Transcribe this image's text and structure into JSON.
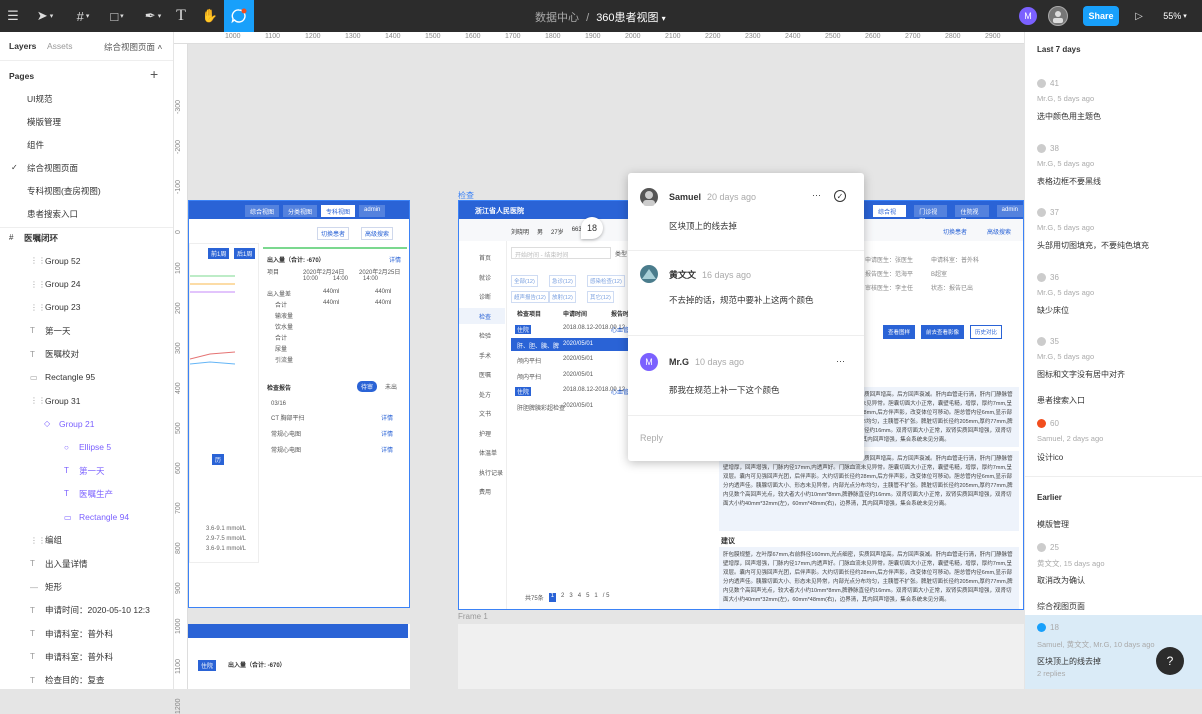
{
  "toolbar": {
    "breadcrumb_parent": "数据中心",
    "breadcrumb_sep": "/",
    "file_name": "360患者视图",
    "avatar_letter": "M",
    "share_label": "Share",
    "zoom": "55%"
  },
  "left_panel": {
    "tab_layers": "Layers",
    "tab_assets": "Assets",
    "page_select": "综合视图页面",
    "pages_title": "Pages",
    "pages": [
      "UI规范",
      "模版管理",
      "组件",
      "综合视图页面",
      "专科视图(查房视图)",
      "患者搜索入口"
    ],
    "current_page_index": 3,
    "layers": [
      {
        "icon": "#",
        "label": "医嘱闭环",
        "indent": 0
      },
      {
        "icon": "⋮⋮",
        "label": "Group 52",
        "indent": 1
      },
      {
        "icon": "⋮⋮",
        "label": "Group 24",
        "indent": 1
      },
      {
        "icon": "⋮⋮",
        "label": "Group 23",
        "indent": 1
      },
      {
        "icon": "T",
        "label": "第一天",
        "indent": 1
      },
      {
        "icon": "T",
        "label": "医嘱校对",
        "indent": 1
      },
      {
        "icon": "▭",
        "label": "Rectangle 95",
        "indent": 1
      },
      {
        "icon": "⋮⋮",
        "label": "Group 31",
        "indent": 1
      },
      {
        "icon": "◇",
        "label": "Group 21",
        "indent": 2
      },
      {
        "icon": "○",
        "label": "Ellipse 5",
        "indent": 3
      },
      {
        "icon": "T",
        "label": "第一天",
        "indent": 3
      },
      {
        "icon": "T",
        "label": "医嘱生产",
        "indent": 3
      },
      {
        "icon": "▭",
        "label": "Rectangle 94",
        "indent": 3
      },
      {
        "icon": "⋮⋮",
        "label": "编组",
        "indent": 1
      },
      {
        "icon": "T",
        "label": "出入量详情",
        "indent": 1
      },
      {
        "icon": "—",
        "label": "矩形",
        "indent": 1
      },
      {
        "icon": "T",
        "label": "申请时间：2020-05-10 12:3",
        "indent": 1
      },
      {
        "icon": "T",
        "label": "申请科室：普外科",
        "indent": 1
      },
      {
        "icon": "T",
        "label": "申请科室：普外科",
        "indent": 1
      },
      {
        "icon": "T",
        "label": "检查目的：复查",
        "indent": 1
      }
    ]
  },
  "ruler": {
    "h": [
      "1000",
      "1100",
      "1200",
      "1300",
      "1400",
      "1500",
      "1600",
      "1700",
      "1800",
      "1900",
      "2000",
      "2100",
      "2200",
      "2300",
      "2400",
      "2500",
      "2600",
      "2700",
      "2800",
      "2900"
    ],
    "v": [
      "-300",
      "-200",
      "-100",
      "0",
      "100",
      "200",
      "300",
      "400",
      "500",
      "600",
      "700",
      "800",
      "900",
      "1000",
      "1100",
      "1200"
    ]
  },
  "canvas": {
    "frame_label_check": "检查",
    "frame_label_frame1": "Frame 1",
    "comment_pin": "18",
    "left_mock": {
      "tabs": [
        "综合视图",
        "分类视图",
        "专科视图",
        "admin"
      ],
      "btn1": "切换患者",
      "btn2": "高级搜索",
      "io_title": "出入量（合计: -670）",
      "io_detail": "详情",
      "io_head": [
        "项目",
        "2020年2月24日",
        "2020年2月25日"
      ],
      "io_times": [
        "10:00",
        "14:00",
        "14:00"
      ],
      "io_rows": [
        [
          "出入量差",
          "440ml",
          "440ml"
        ],
        [
          "合计",
          "440ml",
          "440ml"
        ],
        [
          "输液量",
          "",
          ""
        ],
        [
          "饮水量",
          "",
          ""
        ],
        [
          "合计",
          "",
          ""
        ],
        [
          "尿量",
          "",
          ""
        ],
        [
          "引流量",
          "",
          ""
        ]
      ],
      "report_title": "检查报告",
      "report_toggle": [
        "待审",
        "未出"
      ],
      "report_date": "03/16",
      "reports": [
        [
          "CT 胸部平扫",
          "详情"
        ],
        [
          "常规心电图",
          "详情"
        ],
        [
          "常规心电图",
          "详情"
        ]
      ],
      "week_tabs": [
        "前1周",
        "后1周"
      ],
      "labs": [
        "3.6-9.1 mmol/L",
        "2.9-7.5 mmol/L",
        "3.6-9.1 mmol/L"
      ]
    },
    "main_mock": {
      "hospital": "浙江省人民医院",
      "tabs": [
        "综合视图",
        "门诊视图",
        "住院视图",
        "admin"
      ],
      "patient": [
        "刘晓明",
        "男",
        "27岁",
        "66343"
      ],
      "btn_switch": "切换患者",
      "btn_search": "高级搜索",
      "nav": [
        "首页",
        "就诊",
        "诊断",
        "检查",
        "检验",
        "手术",
        "医嘱",
        "处方",
        "文书",
        "护理",
        "体温单",
        "执行记录",
        "费用"
      ],
      "filters": [
        "类型"
      ],
      "chips": [
        "全部(12)",
        "急诊(12)",
        "感染检查(12)",
        "超声报告(12)",
        "放射(12)",
        "其它(12)"
      ],
      "table_head": [
        "检查项目",
        "申请时间",
        "报告时"
      ],
      "rows": [
        [
          "住院",
          "2018.08.12-2018.09.12",
          "心血管内"
        ],
        [
          "肝、胆、胰、脾",
          "2020/05/01",
          ""
        ],
        [
          "颅内平扫",
          "2020/05/01",
          ""
        ],
        [
          "颅内平扫",
          "2020/05/01",
          ""
        ],
        [
          "住院",
          "2018.08.12-2018.09.12",
          "心血管内"
        ],
        [
          "肝胆脾胰彩超检查",
          "2020/05/01",
          ""
        ]
      ],
      "pager": [
        "共75条",
        "1",
        "2",
        "3",
        "4",
        "5",
        "1",
        "/ 5"
      ],
      "detail_right": [
        [
          "申请医生：张医生",
          "申请科室：普外科"
        ],
        [
          "报告医生：范海平",
          "B超室"
        ],
        [
          "审核医生：李主任",
          "状态：报告已出"
        ]
      ],
      "detail_times": [
        "12:38:33",
        "17:23:23",
        "18:09:02"
      ],
      "detail_btns": [
        "查看图样",
        "前去查看影像",
        "历史对比"
      ],
      "advice_title": "建议",
      "report_text": "肝包膜规整，左叶厚67mm,右前斜径160mm,光点细密，实质回声增高。后方回声衰减。肝内血管走行清，肝内门静脉管壁增厚，回声增强，门脉内径17mm,内透声好。门脉血流未见异常。胆囊切面大小正常，囊壁毛糙，增厚，厚约7mm,呈双层。囊内可见强回声光团，后伴声影。大约切面长径约28mm,后方伴声影，改变体位可移动。胆总管内径6mm,显示部分内透声佳。胰腺切面大小、形态未见异常，内部光点分布均匀，主胰管不扩张。脾脏切面长径约205mm,厚约77mm,脾内见数个高回声光点，较大者大小约10mm*8mm,脾静脉直径约16mm。双肾切面大小正常，双肾实质回声增强，双肾切面大小约40mm*32mm(左)，60mm*48mm(右)，边界清，其内回声增强，集合系统未见分离。"
    }
  },
  "comment": {
    "items": [
      {
        "name": "Samuel",
        "time": "20 days ago",
        "text": "区块顶上的线去掉"
      },
      {
        "name": "黄文文",
        "time": "16 days ago",
        "text": "不去掉的话，规范中要补上这两个颜色"
      },
      {
        "name": "Mr.G",
        "time": "10 days ago",
        "text": "那我在规范上补一下这个颜色"
      }
    ],
    "mrg_letter": "M",
    "reply_placeholder": "Reply",
    "more": "···",
    "check": "✓"
  },
  "right_panel": {
    "section_recent": "Last 7 days",
    "section_earlier": "Earlier",
    "recent": [
      {
        "num": "41",
        "meta": "Mr.G, 5 days ago",
        "msg": "选中颜色用主题色"
      },
      {
        "num": "38",
        "meta": "Mr.G, 5 days ago",
        "msg": "表格边框不要黑线"
      },
      {
        "num": "37",
        "meta": "Mr.G, 5 days ago",
        "msg": "头部用切图填充，不要纯色填充"
      },
      {
        "num": "36",
        "meta": "Mr.G, 5 days ago",
        "msg": "缺少床位"
      },
      {
        "num": "35",
        "meta": "Mr.G, 5 days ago",
        "msg": "图标和文字没有居中对齐"
      }
    ],
    "group_label_1": "患者搜索入口",
    "search_item": {
      "num": "60",
      "meta": "Samuel, 2 days ago",
      "msg": "设计ico",
      "color": "#f24e1e"
    },
    "group_label_2": "模版管理",
    "earlier_item": {
      "num": "25",
      "meta": "黄文文, 15 days ago",
      "msg": "取消改为确认"
    },
    "group_label_3": "综合视图页面",
    "selected_item": {
      "num": "18",
      "meta": "Samuel, 黄文文, Mr.G, 10 days ago",
      "msg": "区块顶上的线去掉",
      "replies": "2 replies",
      "color": "#18a0fb"
    },
    "help": "?"
  },
  "colors": {
    "accent": "#18a0fb",
    "toolbar": "#2c2c2c",
    "mock_blue": "#2a63d6",
    "red": "#f24e1e"
  }
}
